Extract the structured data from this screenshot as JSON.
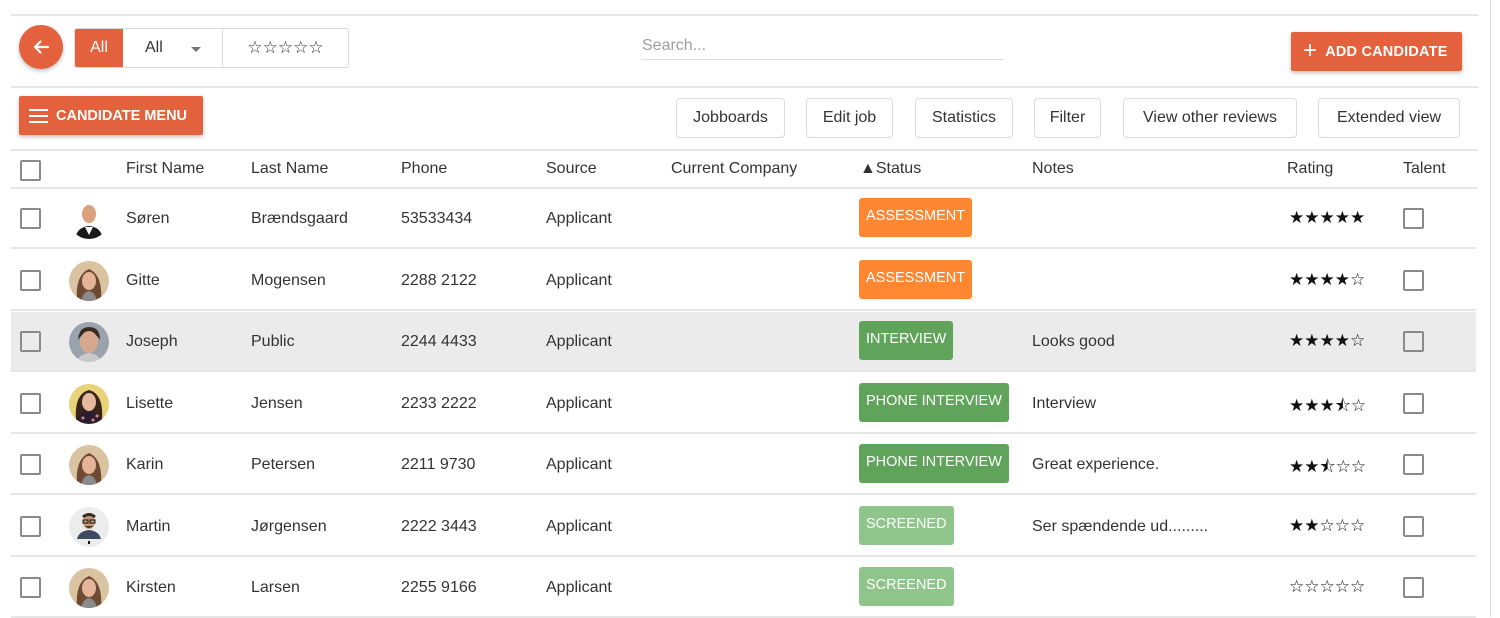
{
  "colors": {
    "accent": "#e4613e",
    "assessment": "#ff8732",
    "interview": "#5fa45a",
    "phone_interview": "#5fa45a",
    "screened": "#8fc58a"
  },
  "toolbar": {
    "back_icon": "arrow-left-icon",
    "filter_all_label": "All",
    "filter_select_value": "All",
    "rating_filter": "☆☆☆☆☆",
    "search_placeholder": "Search...",
    "search_value": "",
    "add_candidate_label": "ADD CANDIDATE",
    "candidate_menu_label": "CANDIDATE MENU",
    "buttons": [
      {
        "label": "Jobboards"
      },
      {
        "label": "Edit job"
      },
      {
        "label": "Statistics"
      },
      {
        "label": "Filter"
      },
      {
        "label": "View other reviews"
      },
      {
        "label": "Extended view"
      }
    ]
  },
  "table": {
    "columns": [
      "First Name",
      "Last Name",
      "Phone",
      "Source",
      "Current Company",
      "▲Status",
      "Notes",
      "Rating",
      "Talent"
    ],
    "rows": [
      {
        "first": "Søren",
        "last": "Brændsgaard",
        "phone": "53533434",
        "source": "Applicant",
        "company": "",
        "status": "ASSESSMENT",
        "status_kind": "assessment",
        "notes": "",
        "rating": 5,
        "rating_stars": "★★★★★",
        "talent": false,
        "highlighted": false,
        "avatar": "man-bald"
      },
      {
        "first": "Gitte",
        "last": "Mogensen",
        "phone": "2288 2122",
        "source": "Applicant",
        "company": "",
        "status": "ASSESSMENT",
        "status_kind": "assessment",
        "notes": "",
        "rating": 4,
        "rating_stars": "★★★★☆",
        "talent": false,
        "highlighted": false,
        "avatar": "woman-brown"
      },
      {
        "first": "Joseph",
        "last": "Public",
        "phone": "2244 4433",
        "source": "Applicant",
        "company": "",
        "status": "INTERVIEW",
        "status_kind": "interview",
        "notes": "Looks good",
        "rating": 4,
        "rating_stars": "★★★★☆",
        "talent": false,
        "highlighted": true,
        "avatar": "man-young"
      },
      {
        "first": "Lisette",
        "last": "Jensen",
        "phone": "2233 2222",
        "source": "Applicant",
        "company": "",
        "status": "PHONE INTERVIEW",
        "status_kind": "phone_interview",
        "notes": "Interview",
        "rating": 3.5,
        "rating_stars": "★★★⯪☆",
        "talent": false,
        "highlighted": false,
        "avatar": "woman-dark"
      },
      {
        "first": "Karin",
        "last": "Petersen",
        "phone": "2211 9730",
        "source": "Applicant",
        "company": "",
        "status": "PHONE INTERVIEW",
        "status_kind": "phone_interview",
        "notes": "Great experience.",
        "rating": 2.5,
        "rating_stars": "★★⯪☆☆",
        "talent": false,
        "highlighted": false,
        "avatar": "woman-brown"
      },
      {
        "first": "Martin",
        "last": "Jørgensen",
        "phone": "2222 3443",
        "source": "Applicant",
        "company": "",
        "status": "SCREENED",
        "status_kind": "screened",
        "notes": "Ser spændende ud.........",
        "rating": 2,
        "rating_stars": "★★☆☆☆",
        "talent": false,
        "highlighted": false,
        "avatar": "man-glasses"
      },
      {
        "first": "Kirsten",
        "last": "Larsen",
        "phone": "2255 9166",
        "source": "Applicant",
        "company": "",
        "status": "SCREENED",
        "status_kind": "screened",
        "notes": "",
        "rating": 0,
        "rating_stars": "☆☆☆☆☆",
        "talent": false,
        "highlighted": false,
        "avatar": "woman-brown"
      }
    ]
  }
}
